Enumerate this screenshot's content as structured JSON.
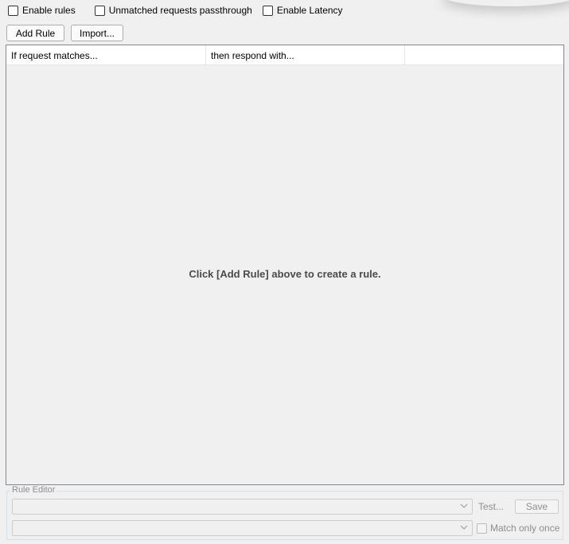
{
  "options": {
    "enable_rules": {
      "label": "Enable rules",
      "checked": false
    },
    "unmatched_passthrough": {
      "label": "Unmatched requests passthrough",
      "checked": false
    },
    "enable_latency": {
      "label": "Enable Latency",
      "checked": false
    }
  },
  "toolbar": {
    "add_rule_label": "Add Rule",
    "import_label": "Import..."
  },
  "rules_table": {
    "columns": [
      "If request matches...",
      "then respond with...",
      ""
    ],
    "rows": [],
    "empty_message": "Click [Add Rule] above to create a rule."
  },
  "rule_editor": {
    "title": "Rule Editor",
    "match_value": "",
    "response_value": "",
    "test_label": "Test...",
    "save_label": "Save",
    "match_once_label": "Match only once",
    "match_once_checked": false,
    "enabled": false
  },
  "colors": {
    "window_bg": "#f0f0f0",
    "table_border": "#828790",
    "disabled_text": "#8e8e8e"
  },
  "icons": {
    "combo_arrow": "chevron-down-icon"
  }
}
